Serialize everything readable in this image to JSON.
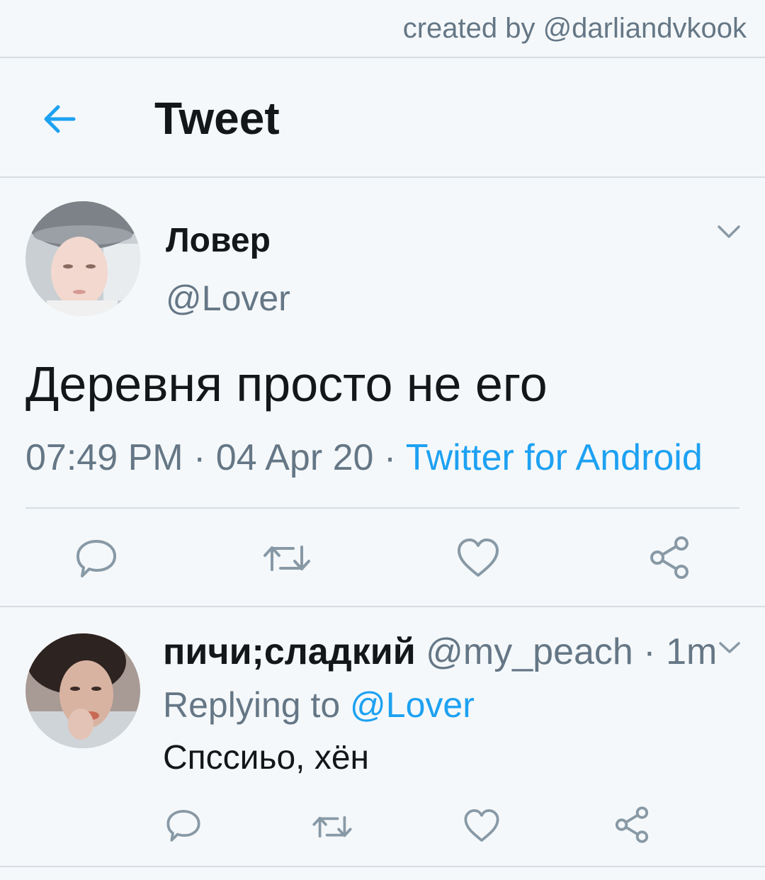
{
  "credit": "created by @darliandvkook",
  "header": {
    "title": "Tweet",
    "back_icon": "arrow-left-icon",
    "accent": "#1da1f2"
  },
  "tweet": {
    "author": {
      "name": "Ловер",
      "handle": "@Lover",
      "avatar": "profile-photo"
    },
    "text": "Деревня просто не его",
    "time": "07:49 PM",
    "separator": " · ",
    "date": "04 Apr 20",
    "source": "Twitter for Android",
    "actions": [
      "reply-icon",
      "retweet-icon",
      "like-icon",
      "share-icon"
    ]
  },
  "reply": {
    "author": {
      "name": "пичи;сладкий",
      "handle": "@my_peach",
      "avatar": "profile-photo"
    },
    "separator": " · ",
    "time": "1m",
    "replying_prefix": "Replying to ",
    "replying_to": "@Lover",
    "text": "Спссиьо, хён",
    "actions": [
      "reply-icon",
      "retweet-icon",
      "like-icon",
      "share-icon"
    ]
  },
  "colors": {
    "background": "#f5f8fa",
    "text": "#14171a",
    "secondary": "#657786",
    "link": "#1da1f2",
    "divider": "#d7dde2"
  }
}
